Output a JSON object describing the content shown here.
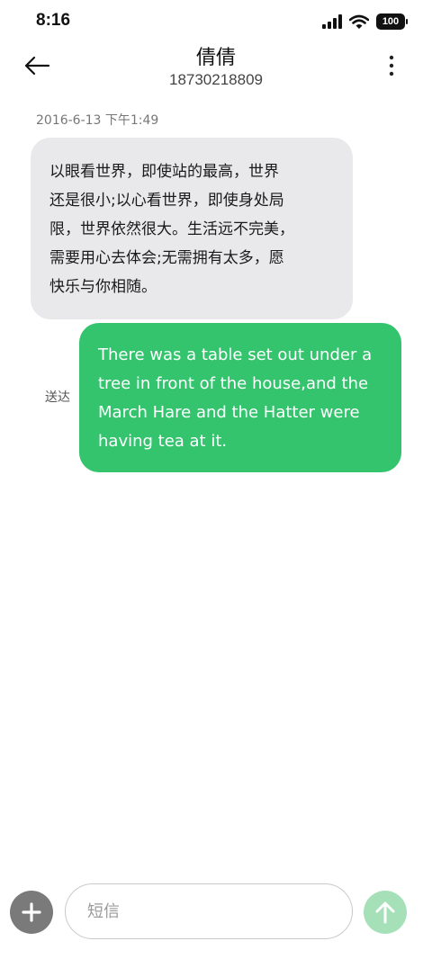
{
  "status_bar": {
    "time": "8:16",
    "battery": "100",
    "icons": [
      "signal-icon",
      "wifi-icon",
      "battery-icon"
    ]
  },
  "header": {
    "contact_name": "倩倩",
    "contact_number": "18730218809",
    "icons": [
      "back-arrow-icon",
      "more-vertical-icon"
    ]
  },
  "conversation": {
    "timestamp": "2016-6-13 下午1:49",
    "messages": [
      {
        "direction": "received",
        "lines": [
          "以眼看世界，即使站的最高，世界",
          "还是很小;以心看世界，即使身处局",
          "限，世界依然很大。生活远不完美，",
          "需要用心去体会;无需拥有太多，愿",
          "快乐与你相随。"
        ]
      },
      {
        "direction": "sent",
        "lines": [
          "There was a table set out under a",
          "tree in front of the house,and the",
          "March Hare and the Hatter were",
          "having tea at it."
        ],
        "status": "送达"
      }
    ]
  },
  "composer": {
    "placeholder": "短信",
    "value": "",
    "icons": [
      "plus-icon",
      "send-arrow-icon"
    ]
  },
  "colors": {
    "sent_bubble": "#34c46e",
    "received_bubble": "#e9e9eb",
    "send_button": "#a6e0b9",
    "attach_button": "#7a7a7a"
  }
}
